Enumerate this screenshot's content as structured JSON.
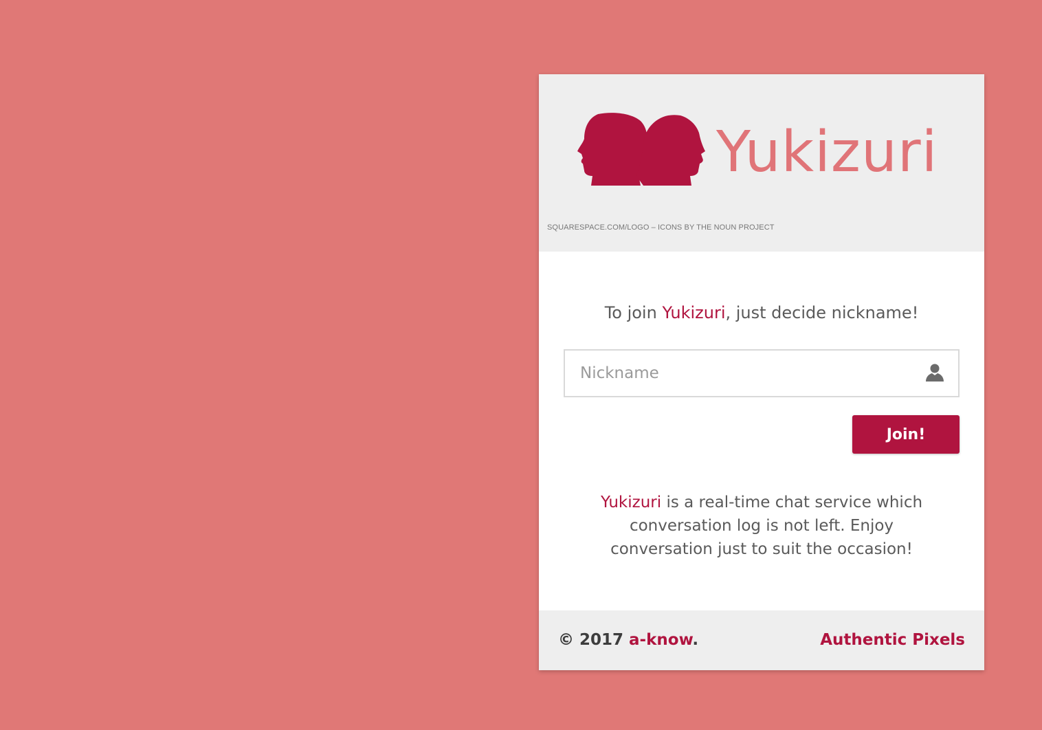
{
  "logo": {
    "wordmark": "Yukizuri",
    "credit": "SQUARESPACE.COM/LOGO – ICONS BY THE NOUN PROJECT"
  },
  "intro": {
    "prefix": "To join ",
    "brand": "Yukizuri",
    "suffix": ", just decide nickname!"
  },
  "nickname_input": {
    "placeholder": "Nickname",
    "value": ""
  },
  "join_button": {
    "label": "Join!"
  },
  "description": {
    "brand": "Yukizuri",
    "text": " is a real-time chat service which conversation log is not left. Enjoy conversation just to suit the occasion!"
  },
  "footer": {
    "copyright_prefix": "© 2017 ",
    "author_link": "a-know",
    "copyright_suffix": ".",
    "right_link": "Authentic Pixels"
  },
  "colors": {
    "background": "#e07876",
    "accent": "#b0143f",
    "wordmark": "#e07478",
    "panel": "#eeeeee"
  },
  "icons": [
    "two-heads-logo-icon",
    "user-icon"
  ]
}
